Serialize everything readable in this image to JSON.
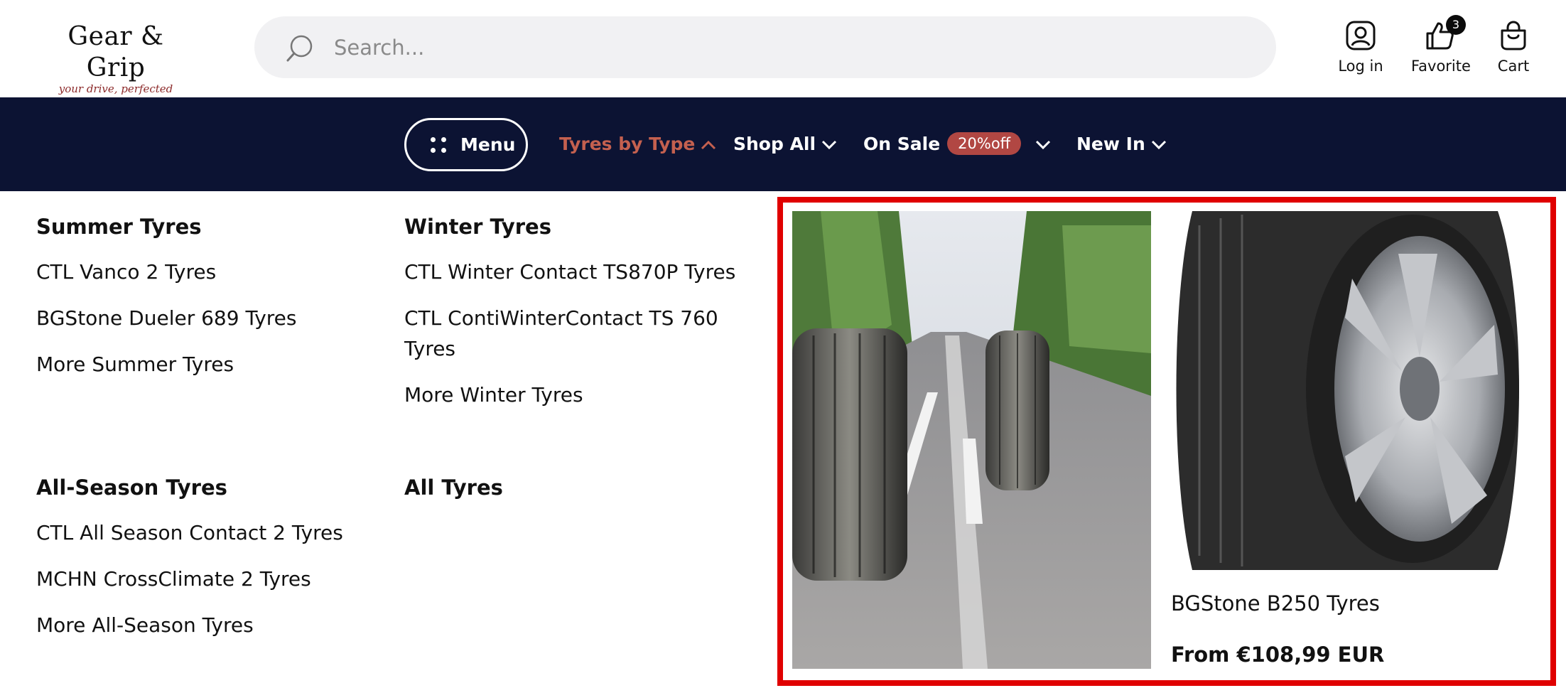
{
  "header": {
    "logo": {
      "name": "Gear & Grip",
      "tagline": "your drive, perfected"
    },
    "search": {
      "placeholder": "Search..."
    },
    "actions": [
      {
        "label": "Log in",
        "icon": "user-icon"
      },
      {
        "label": "Favorite",
        "icon": "thumbs-up-icon",
        "badge": "3"
      },
      {
        "label": "Cart",
        "icon": "shopping-bag-icon"
      }
    ]
  },
  "nav": {
    "menu_label": "Menu",
    "items": [
      {
        "label": "Tyres by Type",
        "active": true
      },
      {
        "label": "Shop All"
      },
      {
        "label": "On Sale",
        "badge": "20%off"
      },
      {
        "label": "New In"
      }
    ]
  },
  "dropdown": {
    "columns": [
      {
        "title": "Summer Tyres",
        "links": [
          "CTL Vanco 2 Tyres",
          "BGStone Dueler 689 Tyres",
          "More Summer Tyres"
        ]
      },
      {
        "title": "Winter Tyres",
        "links": [
          "CTL Winter Contact TS870P Tyres",
          "CTL ContiWinterContact TS 760 Tyres",
          "More Winter Tyres"
        ]
      },
      {
        "title": "All-Season Tyres",
        "links": [
          "CTL All Season Contact 2 Tyres",
          "MCHN CrossClimate 2 Tyres",
          "More All-Season Tyres"
        ]
      },
      {
        "title": "All Tyres",
        "links": []
      }
    ],
    "featured": {
      "product_name": "BGStone B250 Tyres",
      "price": "From €108,99 EUR"
    }
  },
  "colors": {
    "nav_bg": "#0c1333",
    "accent": "#c4604f",
    "sale_badge": "#b14743",
    "highlight": "#e00000"
  }
}
